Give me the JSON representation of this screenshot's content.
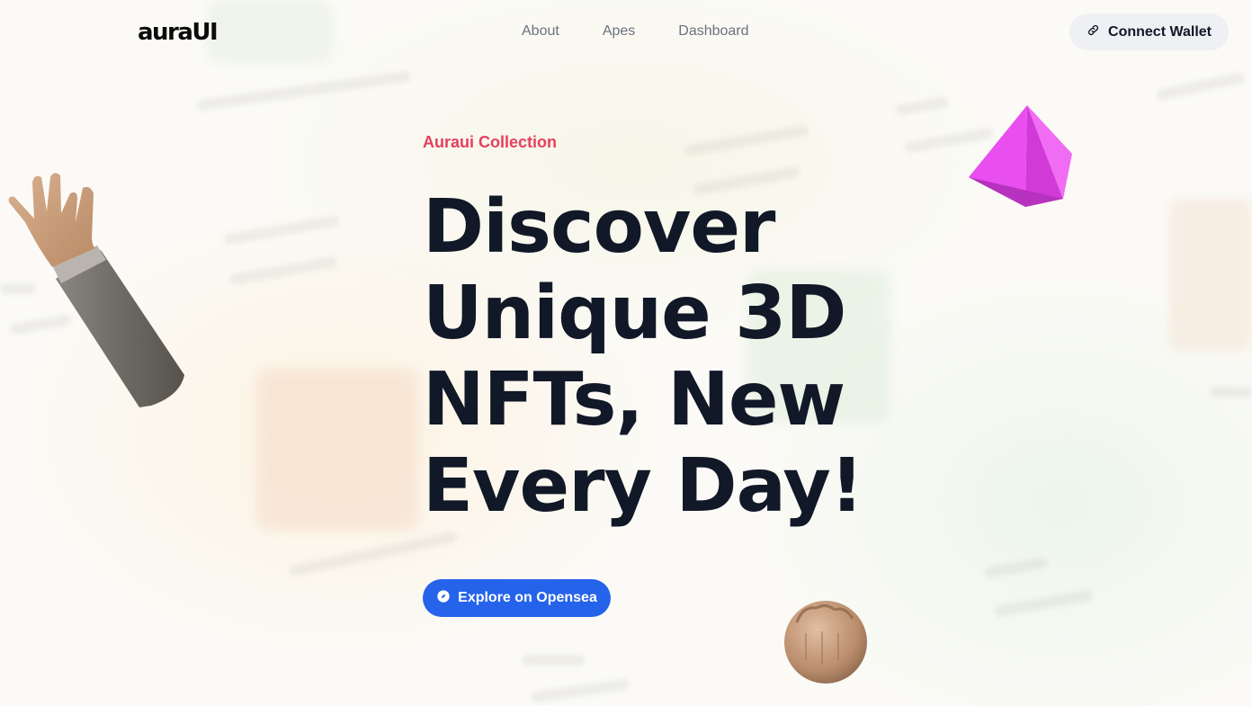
{
  "header": {
    "logo": "auraUI",
    "nav": [
      {
        "label": "About"
      },
      {
        "label": "Apes"
      },
      {
        "label": "Dashboard"
      }
    ],
    "connect_label": "Connect Wallet",
    "connect_icon": "link-icon"
  },
  "hero": {
    "eyebrow": "Auraui Collection",
    "headline_lines": [
      "Discover",
      "Unique 3D",
      "NFTs, New",
      "Every Day!"
    ],
    "cta_label": "Explore on Opensea",
    "cta_icon": "compass-icon"
  },
  "colors": {
    "accent_blue": "#2563eb",
    "eyebrow_pink": "#e5405e",
    "headline": "#111827",
    "crystal_magenta": "#e94ff0"
  }
}
